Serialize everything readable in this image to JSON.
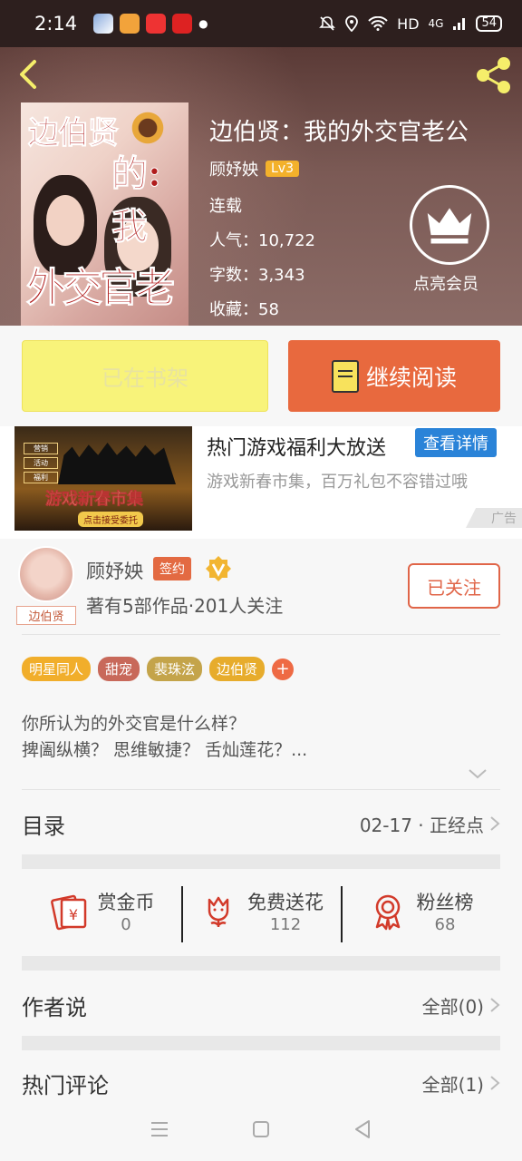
{
  "status_bar": {
    "time": "2:14",
    "network": "HD",
    "signal": "4G",
    "battery": "54"
  },
  "book": {
    "title": "边伯贤：我的外交官老公",
    "author": "顾妤姎",
    "level": "Lv3",
    "status": "连载",
    "popularity": "人气：10,722",
    "word_count": "字数：3,343",
    "favorites": "收藏：58",
    "vip_label": "点亮会员",
    "cover_text": [
      "边伯贤",
      "的:我",
      "外交官老公"
    ]
  },
  "actions": {
    "shelf_label": "已在书架",
    "read_label": "继续阅读"
  },
  "ad": {
    "title": "热门游戏福利大放送",
    "button": "查看详情",
    "description": "游戏新春市集，百万礼包不容错过哦",
    "tag": "广告",
    "image_title": "游戏新春市集",
    "image_sub": "点击接受委托",
    "image_menu": [
      "营销",
      "活动",
      "福利"
    ]
  },
  "author_card": {
    "name": "顾妤姎",
    "sign_badge": "签约",
    "info": "著有5部作品·201人关注",
    "follow_label": "已关注",
    "avatar_tag": "边伯贤"
  },
  "tags": [
    {
      "label": "明星同人",
      "color": "#f1ae2b"
    },
    {
      "label": "甜宠",
      "color": "#c8695a"
    },
    {
      "label": "裴珠泫",
      "color": "#c4a44a"
    },
    {
      "label": "边伯贤",
      "color": "#e7ac2c"
    }
  ],
  "tag_more": "+",
  "description": {
    "line1": "你所认为的外交官是什么样？",
    "line2": "捭阖纵横？ 思维敏捷？ 舌灿莲花？..."
  },
  "catalog": {
    "label": "目录",
    "latest": "02-17 · 正经点"
  },
  "stats": [
    {
      "label": "赏金币",
      "value": "0",
      "icon": "red-envelope-icon"
    },
    {
      "label": "免费送花",
      "value": "112",
      "icon": "flower-icon"
    },
    {
      "label": "粉丝榜",
      "value": "68",
      "icon": "medal-icon"
    }
  ],
  "author_says": {
    "label": "作者说",
    "link": "全部(0)"
  },
  "hot_comments": {
    "label": "热门评论",
    "link": "全部(1)"
  },
  "colors": {
    "accent": "#e8693e",
    "shelf": "#f8f37a",
    "ad_button": "#2a83d8",
    "lv_badge": "#f3b12b"
  }
}
